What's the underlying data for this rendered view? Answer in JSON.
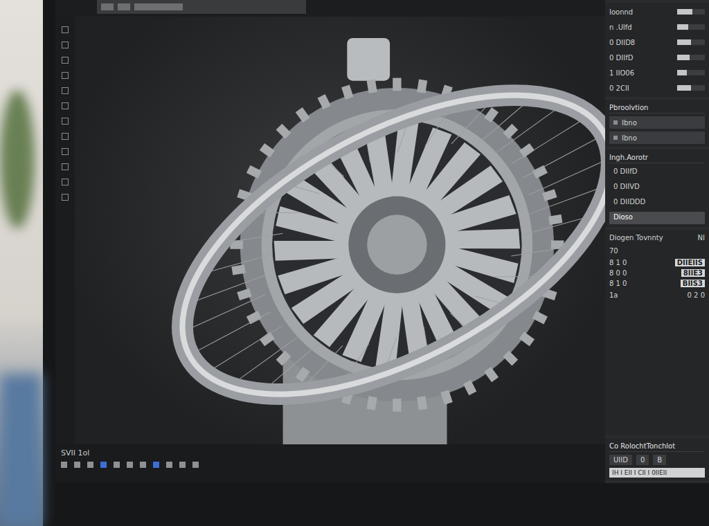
{
  "right_panel": {
    "top_rows": [
      {
        "label": "Ioonnd",
        "level": 0.55
      },
      {
        "label": "n .Ulfd",
        "level": 0.4
      },
      {
        "label": "0 DIID8",
        "level": 0.5
      },
      {
        "label": "0 DIIfD",
        "level": 0.45
      },
      {
        "label": "1 IIO06",
        "level": 0.35
      },
      {
        "label": "0 2CII",
        "level": 0.5
      }
    ],
    "properties": {
      "title": "Pbroolvtion",
      "fields": [
        "Ibno",
        "Ibno"
      ]
    },
    "list": {
      "title": "Ingh.Aorotr",
      "items": [
        {
          "label": "0 DIIfD",
          "selected": false
        },
        {
          "label": "0 DIIVD",
          "selected": false
        },
        {
          "label": "0 DIIDDD",
          "selected": false
        },
        {
          "label": "Dioso",
          "selected": true
        }
      ]
    },
    "stats": {
      "title": "Diogen Tovnnty",
      "value": "NI",
      "note": "70",
      "rows": [
        {
          "cells": [
            "8 1 0",
            "DIIEIIS"
          ]
        },
        {
          "cells": [
            "8 0 0",
            "8IIE3"
          ]
        },
        {
          "cells": [
            "8 1 0",
            "BIIS3"
          ]
        }
      ],
      "footer": [
        "1a",
        "0 2 0"
      ]
    },
    "bottom": {
      "title": "Co RolochtTonchlot",
      "buttons": [
        "UIID",
        "0",
        "B"
      ],
      "strip": "IH I EII I CII I 0IIEII"
    }
  },
  "status_bar": {
    "text": "SVII 1ol"
  }
}
